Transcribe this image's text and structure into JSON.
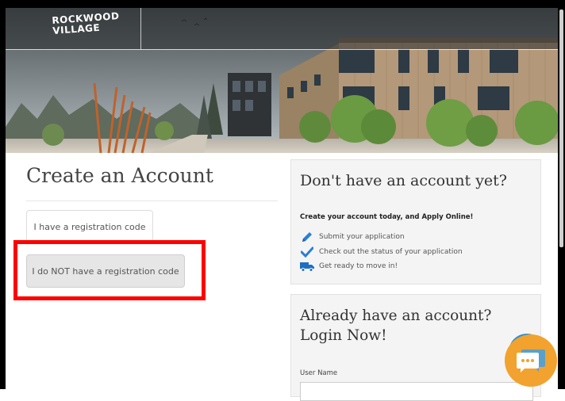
{
  "header": {
    "logo_line1": "ROCKWOOD",
    "logo_line2": "VILLAGE"
  },
  "main": {
    "title": "Create an Account",
    "buttons": {
      "has_code": "I have a registration code",
      "no_code": "I do NOT have a registration code"
    }
  },
  "signup_panel": {
    "heading": "Don't have an account yet?",
    "subheading": "Create your account today, and Apply Online!",
    "features": [
      {
        "icon": "pencil-icon",
        "text": "Submit your application"
      },
      {
        "icon": "checkmark-icon",
        "text": "Check out the status of your application"
      },
      {
        "icon": "truck-icon",
        "text": "Get ready to move in!"
      }
    ]
  },
  "login_panel": {
    "heading": "Already have an account? Login Now!",
    "username_label": "User Name"
  },
  "colors": {
    "highlight": "#ff0000",
    "chat_widget": "#f2a22e",
    "icon_blue": "#2a7fd4",
    "truck_blue": "#1e6fc2"
  }
}
